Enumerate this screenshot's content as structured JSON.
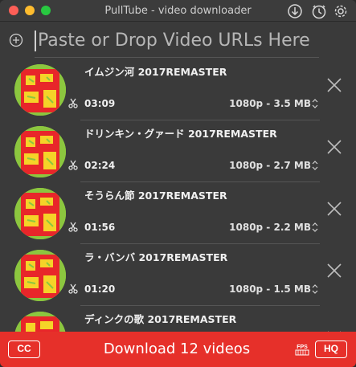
{
  "window": {
    "title": "PullTube - video downloader"
  },
  "toolbar": {
    "download_icon": "download-circle-icon",
    "clock_icon": "clock-icon",
    "settings_icon": "gear-icon"
  },
  "url_bar": {
    "placeholder": "Paste or Drop Video URLs Here",
    "add_icon": "plus-circle-icon"
  },
  "videos": [
    {
      "title": "イムジン河 2017REMASTER",
      "duration": "03:09",
      "quality": "1080p - 3.5 MB"
    },
    {
      "title": "ドリンキン・グァード 2017REMASTER",
      "duration": "02:24",
      "quality": "1080p - 2.7 MB"
    },
    {
      "title": "そうらん節 2017REMASTER",
      "duration": "01:56",
      "quality": "1080p - 2.2 MB"
    },
    {
      "title": "ラ・バンバ 2017REMASTER",
      "duration": "01:20",
      "quality": "1080p - 1.5 MB"
    },
    {
      "title": "ディンクの歌 2017REMASTER",
      "duration": "",
      "quality": ""
    }
  ],
  "bottom_bar": {
    "cc_label": "CC",
    "download_label": "Download 12 videos",
    "fps_label": "FPS",
    "hq_label": "HQ",
    "accent_color": "#e6302a"
  }
}
